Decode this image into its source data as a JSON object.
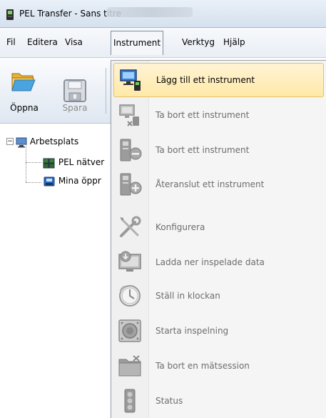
{
  "window": {
    "title": "PEL Transfer - Sans titre"
  },
  "menubar": {
    "items": [
      "Fil",
      "Editera",
      "Visa",
      "Instrument",
      "Verktyg",
      "Hjälp"
    ]
  },
  "toolbar": {
    "open_label": "Öppna",
    "save_label": "Spara"
  },
  "tree": {
    "root": "Arbetsplats",
    "children": [
      "PEL nätver",
      "Mina öppr"
    ]
  },
  "instrument_menu": {
    "items": [
      {
        "label": "Lägg till ett instrument",
        "icon": "add-instrument-icon",
        "state": "highlighted"
      },
      {
        "label": "Ta bort ett instrument",
        "icon": "remove-instrument-icon",
        "state": "disabled"
      },
      {
        "label": "Ta bort ett instrument",
        "icon": "remove-instrument-minus-icon",
        "state": "disabled"
      },
      {
        "label": "Återanslut ett instrument",
        "icon": "reconnect-instrument-icon",
        "state": "disabled"
      },
      {
        "label": "Konfigurera",
        "icon": "configure-tools-icon",
        "state": "disabled"
      },
      {
        "label": "Ladda ner inspelade data",
        "icon": "download-data-icon",
        "state": "disabled"
      },
      {
        "label": "Ställ in klockan",
        "icon": "clock-icon",
        "state": "disabled"
      },
      {
        "label": "Starta inspelning",
        "icon": "start-recording-icon",
        "state": "disabled"
      },
      {
        "label": "Ta bort en mätsession",
        "icon": "delete-session-folder-icon",
        "state": "disabled"
      },
      {
        "label": "Status",
        "icon": "status-icon",
        "state": "disabled"
      }
    ]
  },
  "colors": {
    "highlight_bg": "#ffe9a8",
    "highlight_border": "#e3c16b",
    "disabled_text": "#6d6d6d"
  }
}
